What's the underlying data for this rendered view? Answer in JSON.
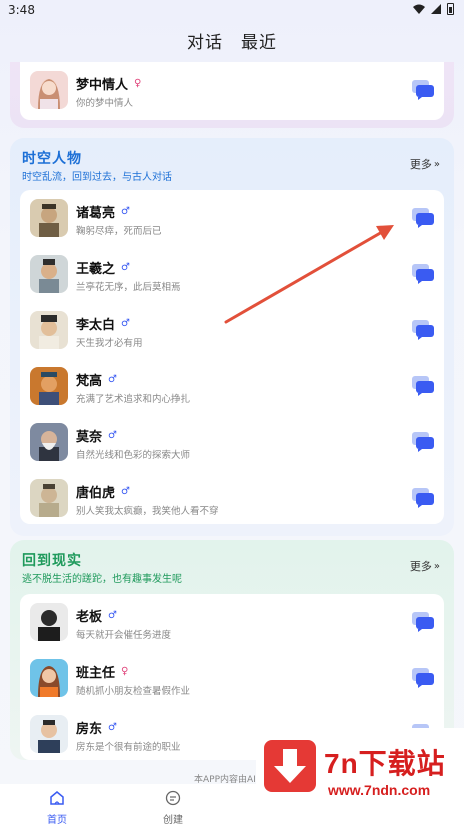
{
  "status": {
    "time": "3:48"
  },
  "tabs": [
    {
      "label": "对话"
    },
    {
      "label": "最近"
    }
  ],
  "top_card": {
    "name": "梦中情人",
    "gender": "♀",
    "desc": "你的梦中情人"
  },
  "section_history": {
    "title": "时空人物",
    "subtitle": "时空乱流，回到过去，与古人对话",
    "more": "更多",
    "items": [
      {
        "name": "诸葛亮",
        "gender": "♂",
        "desc": "鞠躬尽瘁，死而后已"
      },
      {
        "name": "王羲之",
        "gender": "♂",
        "desc": "兰亭花无序，此后莫相焉"
      },
      {
        "name": "李太白",
        "gender": "♂",
        "desc": "天生我才必有用"
      },
      {
        "name": "梵高",
        "gender": "♂",
        "desc": "充满了艺术追求和内心挣扎"
      },
      {
        "name": "莫奈",
        "gender": "♂",
        "desc": "自然光线和色彩的探索大师"
      },
      {
        "name": "唐伯虎",
        "gender": "♂",
        "desc": "别人笑我太疯癫，我笑他人看不穿"
      }
    ]
  },
  "section_reality": {
    "title": "回到现实",
    "subtitle": "逃不脱生活的蹉跎，也有趣事发生呢",
    "more": "更多",
    "items": [
      {
        "name": "老板",
        "gender": "♂",
        "desc": "每天就开会催任务进度"
      },
      {
        "name": "班主任",
        "gender": "♀",
        "desc": "随机抓小朋友检查暑假作业"
      },
      {
        "name": "房东",
        "gender": "♂",
        "desc": "房东是个很有前途的职业"
      }
    ]
  },
  "footer": {
    "note": "本APP内容由AI"
  },
  "nav": [
    {
      "label": "首页"
    },
    {
      "label": "创建"
    }
  ],
  "watermark": {
    "main": "7n下载站",
    "url": "www.7ndn.com"
  },
  "colors": {
    "accent": "#3a5bf2",
    "history_title": "#1c6fd6",
    "reality_title": "#1f9a5c",
    "female": "#e0457b",
    "male": "#3a5bf2",
    "annotation_arrow": "#e2503a"
  }
}
